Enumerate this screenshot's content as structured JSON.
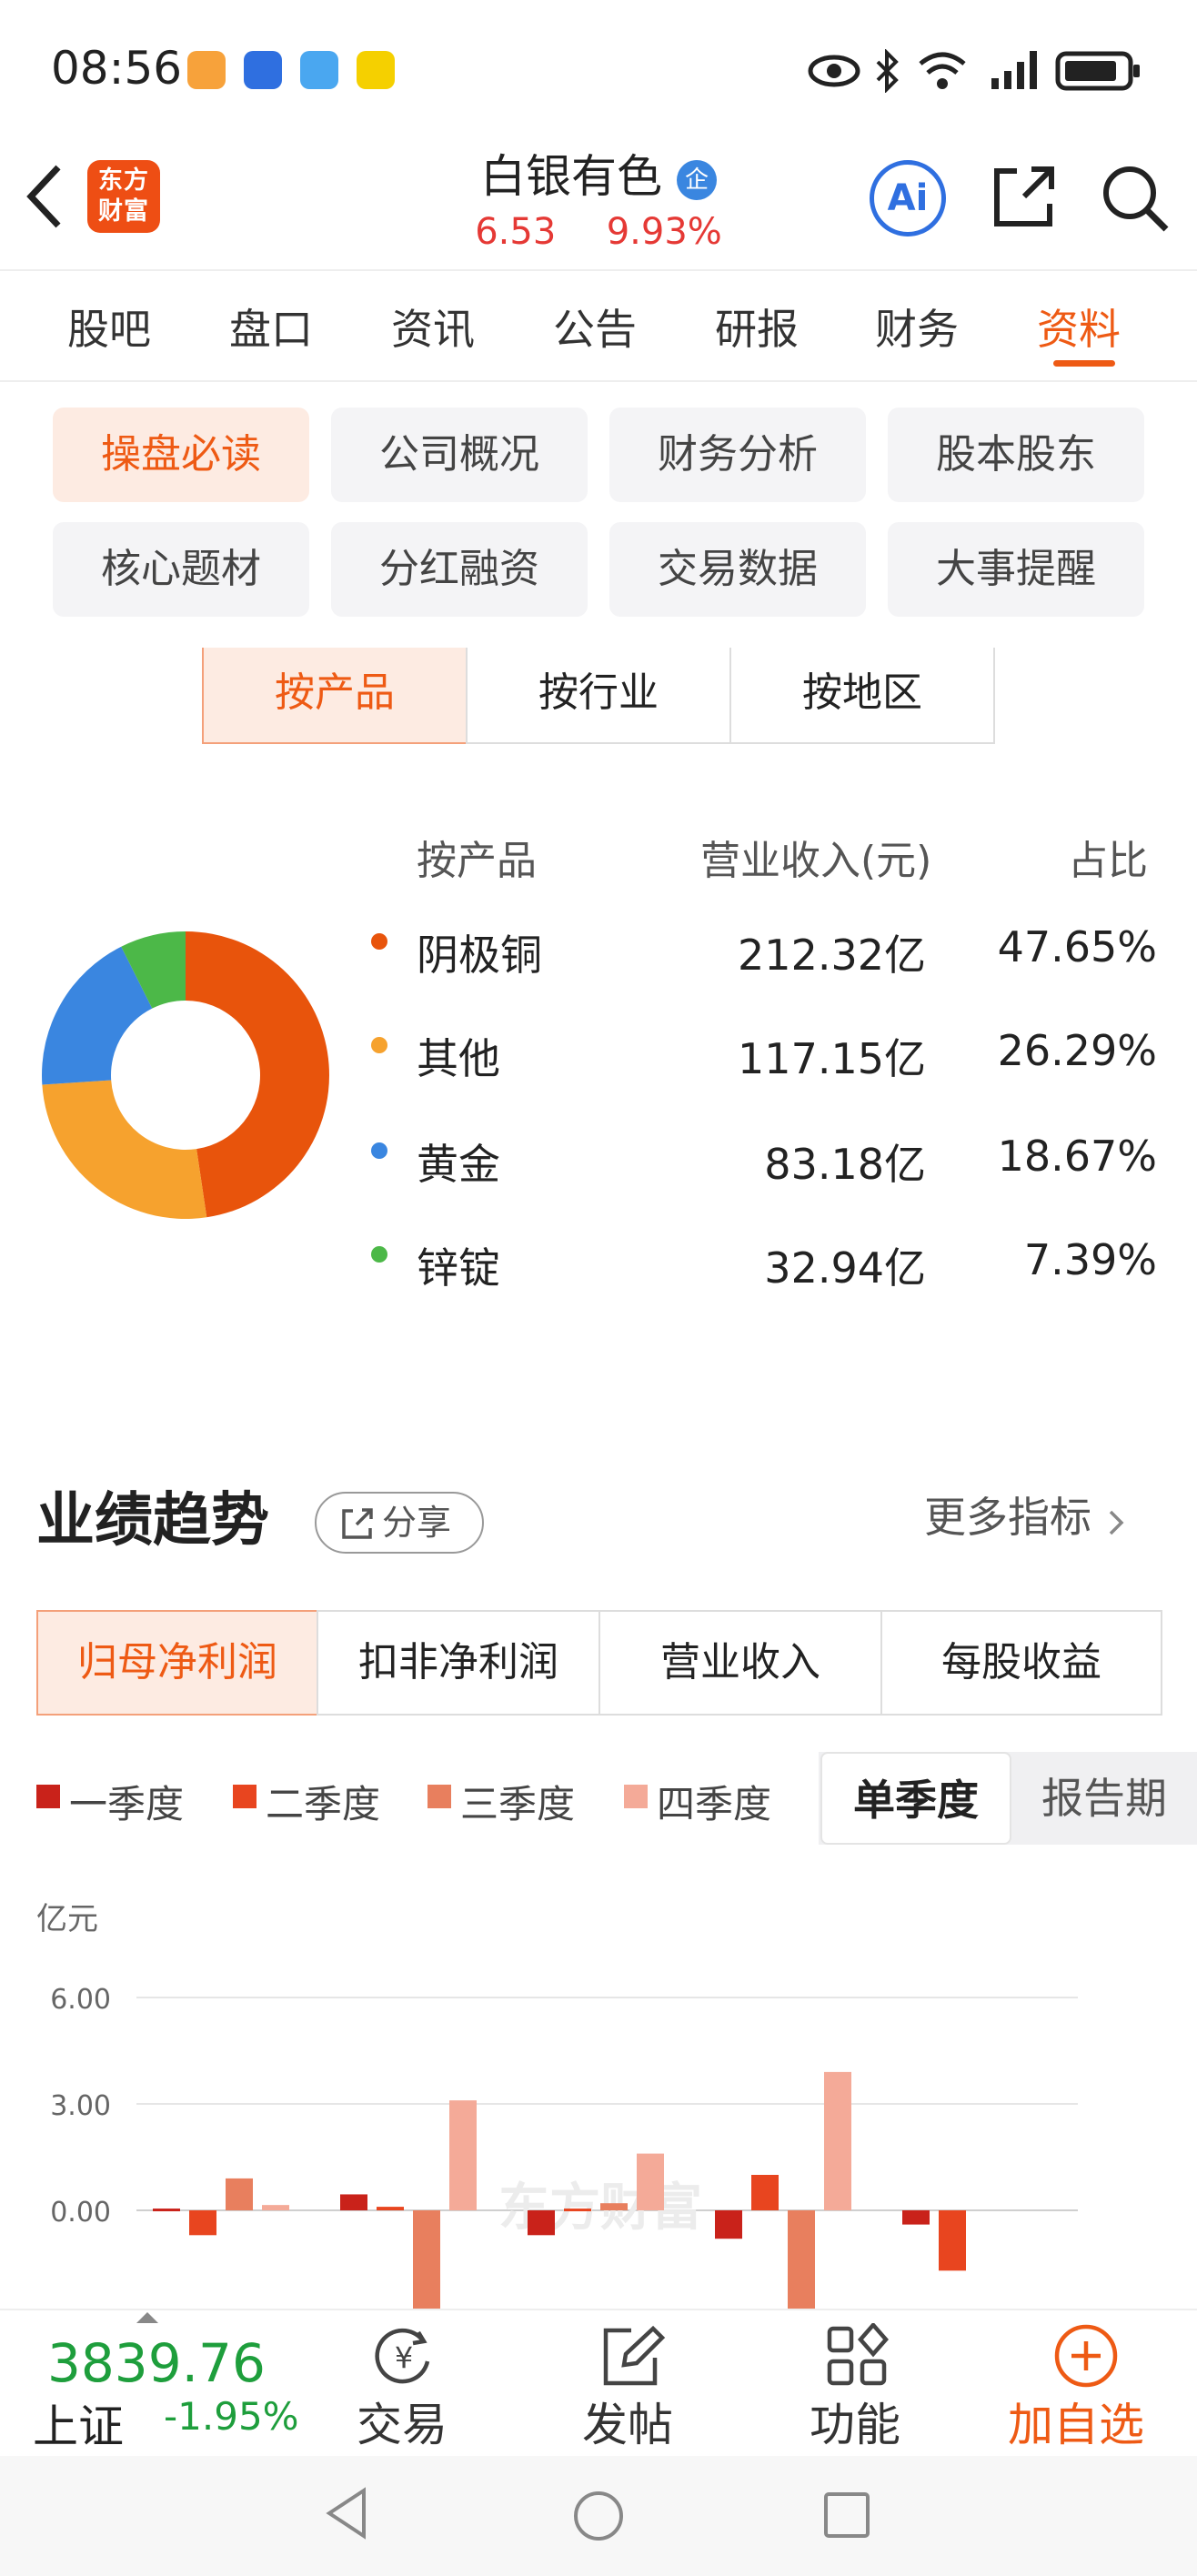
{
  "status_bar": {
    "time": "08:56"
  },
  "header": {
    "app_logo_text": "东方财富",
    "stock_name": "白银有色",
    "stock_badge": "企",
    "price": "6.53",
    "change_pct": "9.93%",
    "ai_label": "Ai"
  },
  "tabs": [
    "股吧",
    "盘口",
    "资讯",
    "公告",
    "研报",
    "财务",
    "资料"
  ],
  "active_tab": "资料",
  "chips": [
    "操盘必读",
    "公司概况",
    "财务分析",
    "股本股东",
    "核心题材",
    "分红融资",
    "交易数据",
    "大事提醒"
  ],
  "segments": [
    "按产品",
    "按行业",
    "按地区"
  ],
  "revenue": {
    "headers": [
      "按产品",
      "营业收入(元)",
      "占比"
    ],
    "rows": [
      {
        "name": "阴极铜",
        "revenue": "212.32亿",
        "pct": "47.65%",
        "value": 47.65,
        "color": "#e8540c"
      },
      {
        "name": "其他",
        "revenue": "117.15亿",
        "pct": "26.29%",
        "value": 26.29,
        "color": "#f6a22e"
      },
      {
        "name": "黄金",
        "revenue": "83.18亿",
        "pct": "18.67%",
        "value": 18.67,
        "color": "#3a86e0"
      },
      {
        "name": "锌锭",
        "revenue": "32.94亿",
        "pct": "7.39%",
        "value": 7.39,
        "color": "#4cb848"
      }
    ]
  },
  "performance": {
    "title": "业绩趋势",
    "share_label": "分享",
    "more_label": "更多指标",
    "metric_tabs": [
      "归母净利润",
      "扣非净利润",
      "营业收入",
      "每股收益"
    ],
    "legend": [
      {
        "label": "一季度",
        "color": "#c9221a"
      },
      {
        "label": "二季度",
        "color": "#e8451f"
      },
      {
        "label": "三季度",
        "color": "#e87f5e"
      },
      {
        "label": "四季度",
        "color": "#f4aa98"
      }
    ],
    "period_tabs": [
      "单季度",
      "报告期"
    ],
    "unit": "亿元",
    "watermark": "东方财富"
  },
  "chart_data": {
    "type": "bar",
    "ylabel": "亿元",
    "yticks": [
      "6.00",
      "3.00",
      "0.00"
    ],
    "ylim": [
      -3,
      6
    ],
    "series": [
      {
        "name": "一季度",
        "values": [
          0.05,
          0.45,
          -0.7,
          -0.8,
          -0.4
        ]
      },
      {
        "name": "二季度",
        "values": [
          -0.7,
          0.1,
          0.05,
          1.0,
          -1.7
        ]
      },
      {
        "name": "三季度",
        "values": [
          0.9,
          -3.0,
          0.2,
          -3.0,
          null
        ]
      },
      {
        "name": "四季度",
        "values": [
          0.15,
          3.1,
          1.6,
          3.9,
          null
        ]
      }
    ]
  },
  "bottom_nav": {
    "index_value": "3839.76",
    "index_name": "上证",
    "index_change": "-1.95%",
    "items": [
      "交易",
      "发帖",
      "功能",
      "加自选"
    ]
  }
}
